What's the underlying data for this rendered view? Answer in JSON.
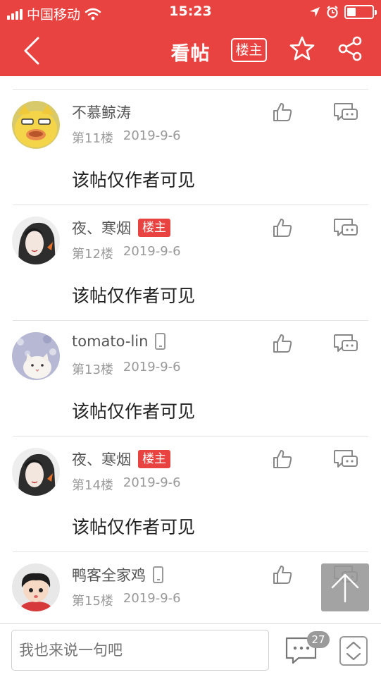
{
  "status_bar": {
    "carrier": "中国移动",
    "time": "15:23"
  },
  "nav": {
    "title": "看帖",
    "owner_only_label": "楼主"
  },
  "owner_badge_label": "楼主",
  "posts": [
    {
      "username": "不慕鲸涛",
      "floor": "第11楼",
      "date": "2019-9-6",
      "content": "该帖仅作者可见",
      "is_owner": false,
      "mobile": false
    },
    {
      "username": "夜、寒烟",
      "floor": "第12楼",
      "date": "2019-9-6",
      "content": "该帖仅作者可见",
      "is_owner": true,
      "mobile": false
    },
    {
      "username": "tomato-lin",
      "floor": "第13楼",
      "date": "2019-9-6",
      "content": "该帖仅作者可见",
      "is_owner": false,
      "mobile": true
    },
    {
      "username": "夜、寒烟",
      "floor": "第14楼",
      "date": "2019-9-6",
      "content": "该帖仅作者可见",
      "is_owner": true,
      "mobile": false
    },
    {
      "username": "鸭客全家鸡",
      "floor": "第15楼",
      "date": "2019-9-6",
      "content": "",
      "is_owner": false,
      "mobile": true
    }
  ],
  "bottom_bar": {
    "input_placeholder": "我也来说一句吧",
    "comment_count": "27"
  },
  "colors": {
    "brand": "#E84340",
    "meta_text": "#999999"
  },
  "icons": {
    "back": "chevron-left-icon",
    "star": "star-icon",
    "share": "share-icon",
    "like": "thumbs-up-icon",
    "reply": "reply-bubble-icon",
    "back_to_top": "arrow-up-icon",
    "comments": "comment-bubble-icon",
    "scroll": "up-down-icon"
  }
}
